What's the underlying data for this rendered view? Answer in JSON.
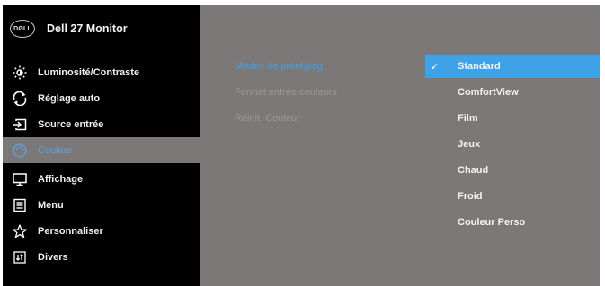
{
  "header": {
    "logo_text": "DØLL",
    "model": "Dell 27 Monitor"
  },
  "sidebar": {
    "items": [
      {
        "label": "Luminosité/Contraste",
        "icon": "brightness-icon",
        "active": false
      },
      {
        "label": "Réglage auto",
        "icon": "auto-adjust-icon",
        "active": false
      },
      {
        "label": "Source entrée",
        "icon": "input-source-icon",
        "active": false
      },
      {
        "label": "Couleur",
        "icon": "color-palette-icon",
        "active": true
      },
      {
        "label": "Affichage",
        "icon": "display-icon",
        "active": false
      },
      {
        "label": "Menu",
        "icon": "menu-icon",
        "active": false
      },
      {
        "label": "Personnaliser",
        "icon": "star-icon",
        "active": false
      },
      {
        "label": "Divers",
        "icon": "others-icon",
        "active": false
      }
    ]
  },
  "submenu": {
    "items": [
      {
        "label": "Modes de préréglag",
        "active": true
      },
      {
        "label": "Format entrée couleurs",
        "active": false
      },
      {
        "label": "Réinit. Couleur",
        "active": false
      }
    ]
  },
  "options": {
    "items": [
      {
        "label": "Standard",
        "selected": true,
        "check": "✓"
      },
      {
        "label": "ComfortView",
        "selected": false
      },
      {
        "label": "Film",
        "selected": false
      },
      {
        "label": "Jeux",
        "selected": false
      },
      {
        "label": "Chaud",
        "selected": false
      },
      {
        "label": "Froid",
        "selected": false
      },
      {
        "label": "Couleur Perso",
        "selected": false
      }
    ]
  },
  "colors": {
    "background": "#000000",
    "panel": "#7c7877",
    "accent": "#3fa2e6",
    "active_text": "#5aa3e3"
  }
}
